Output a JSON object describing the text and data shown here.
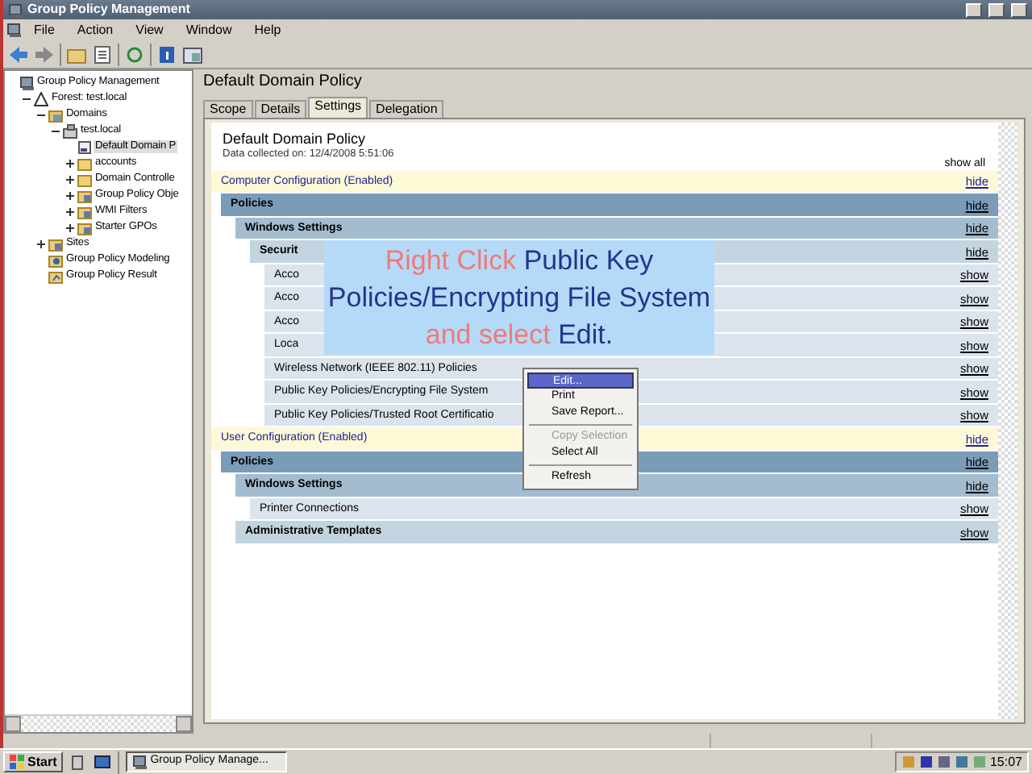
{
  "window": {
    "title": "Group Policy Management"
  },
  "menu": [
    "File",
    "Action",
    "View",
    "Window",
    "Help"
  ],
  "tree": [
    {
      "label": "Group Policy Management",
      "children": [
        {
          "label": "Forest: test.local",
          "expanded": true,
          "children": [
            {
              "label": "Domains",
              "expanded": true,
              "children": [
                {
                  "label": "test.local",
                  "expanded": true,
                  "children": [
                    {
                      "label": "Default Domain P",
                      "selected": true
                    },
                    {
                      "label": "accounts",
                      "expanded": false
                    },
                    {
                      "label": "Domain Controlle",
                      "expanded": false
                    },
                    {
                      "label": "Group Policy Obje",
                      "expanded": false
                    },
                    {
                      "label": "WMI Filters",
                      "expanded": false
                    },
                    {
                      "label": "Starter GPOs",
                      "expanded": false
                    }
                  ]
                }
              ]
            },
            {
              "label": "Sites",
              "expanded": false
            },
            {
              "label": "Group Policy Modeling"
            },
            {
              "label": "Group Policy Result"
            }
          ]
        }
      ]
    }
  ],
  "details": {
    "title": "Default Domain Policy",
    "tabs": [
      {
        "label": "Scope",
        "selected": false
      },
      {
        "label": "Details",
        "selected": false
      },
      {
        "label": "Settings",
        "selected": true
      },
      {
        "label": "Delegation",
        "selected": false
      }
    ],
    "report": {
      "title": "Default Domain Policy",
      "collected": "Data collected on: 12/4/2008 5:51:06",
      "show_all": "show all",
      "rows": [
        {
          "label": "Computer Configuration (Enabled)",
          "link": "hide",
          "children": [
            {
              "label": "Policies",
              "link": "hide",
              "children": [
                {
                  "label": "Windows Settings",
                  "link": "hide",
                  "children": [
                    {
                      "label": "Securit",
                      "link": "hide",
                      "children": [
                        {
                          "label": "Acco",
                          "link": "show"
                        },
                        {
                          "label": "Acco",
                          "link": "show"
                        },
                        {
                          "label": "Acco",
                          "link": "show"
                        },
                        {
                          "label": "Loca",
                          "link": "show"
                        },
                        {
                          "label": "Wireless Network (IEEE 802.11) Policies",
                          "link": "show"
                        },
                        {
                          "label": "Public Key Policies/Encrypting File System",
                          "link": "show"
                        },
                        {
                          "label": "Public Key Policies/Trusted Root Certificatio",
                          "link": "show"
                        }
                      ]
                    }
                  ]
                }
              ]
            }
          ]
        },
        {
          "label": "User Configuration (Enabled)",
          "link": "hide",
          "children": [
            {
              "label": "Policies",
              "link": "hide",
              "children": [
                {
                  "label": "Windows Settings",
                  "link": "hide",
                  "children": [
                    {
                      "label": "Printer Connections",
                      "link": "show"
                    }
                  ]
                },
                {
                  "label": "Administrative Templates",
                  "link": "show"
                }
              ]
            }
          ]
        }
      ]
    }
  },
  "context_menu": [
    {
      "kind": "item",
      "label": "Edit...",
      "selected": true,
      "disabled": false
    },
    {
      "kind": "item",
      "label": "Print",
      "selected": false,
      "disabled": false
    },
    {
      "kind": "item",
      "label": "Save Report...",
      "selected": false,
      "disabled": false
    },
    {
      "kind": "separator"
    },
    {
      "kind": "item",
      "label": "Copy Selection",
      "selected": false,
      "disabled": true
    },
    {
      "kind": "item",
      "label": "Select All",
      "selected": false,
      "disabled": false
    },
    {
      "kind": "separator"
    },
    {
      "kind": "item",
      "label": "Refresh",
      "selected": false,
      "disabled": false
    }
  ],
  "callout": [
    {
      "text": "Right Click",
      "accent": true
    },
    {
      "text": "Public Key Policies/Encrypting File System",
      "accent": false
    },
    {
      "text": "and select",
      "accent": true
    },
    {
      "text": "Edit.",
      "accent": false
    }
  ],
  "taskbar": {
    "start": "Start",
    "task": "Group Policy Manage...",
    "clock": "15:07"
  }
}
